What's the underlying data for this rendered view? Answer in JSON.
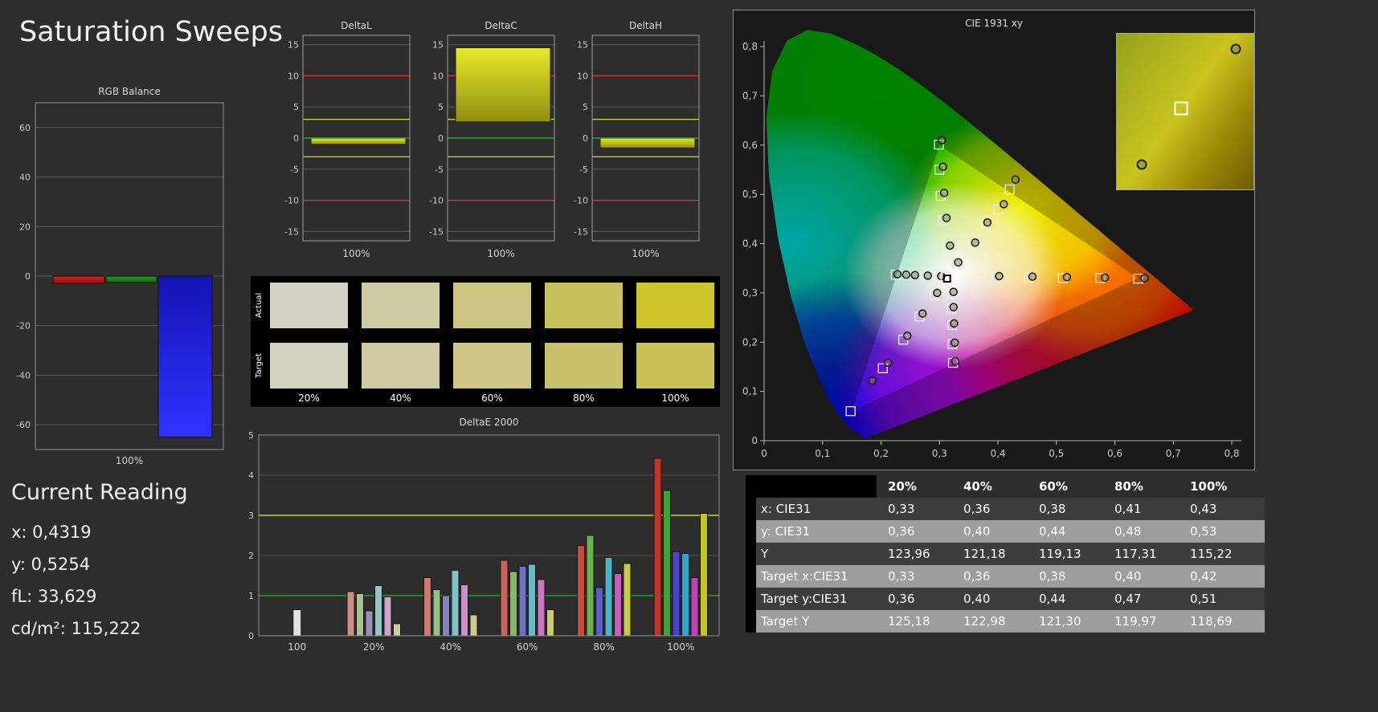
{
  "page_title": "Saturation Sweeps",
  "current_reading": {
    "heading": "Current Reading",
    "lines": [
      "x: 0,4319",
      "y: 0,5254",
      "fL: 33,629",
      "cd/m²: 115,222"
    ]
  },
  "swatches": {
    "row_labels": [
      "Actual",
      "Target"
    ],
    "col_labels": [
      "20%",
      "40%",
      "60%",
      "80%",
      "100%"
    ],
    "actual_colors": [
      "#d2d2c4",
      "#cecaa2",
      "#cbc581",
      "#c9c05e",
      "#cdc72d"
    ],
    "target_colors": [
      "#d4d2c0",
      "#d0cba0",
      "#cdc786",
      "#cac268",
      "#cbc356"
    ]
  },
  "table": {
    "headers": [
      "",
      "20%",
      "40%",
      "60%",
      "80%",
      "100%"
    ],
    "rows": [
      {
        "label": "x: CIE31",
        "shade": "dark",
        "values": [
          "0,33",
          "0,36",
          "0,38",
          "0,41",
          "0,43"
        ]
      },
      {
        "label": "y: CIE31",
        "shade": "light",
        "values": [
          "0,36",
          "0,40",
          "0,44",
          "0,48",
          "0,53"
        ]
      },
      {
        "label": "Y",
        "shade": "dark",
        "values": [
          "123,96",
          "121,18",
          "119,13",
          "117,31",
          "115,22"
        ]
      },
      {
        "label": "Target x:CIE31",
        "shade": "light",
        "values": [
          "0,33",
          "0,36",
          "0,38",
          "0,40",
          "0,42"
        ]
      },
      {
        "label": "Target y:CIE31",
        "shade": "dark",
        "values": [
          "0,36",
          "0,40",
          "0,44",
          "0,47",
          "0,51"
        ]
      },
      {
        "label": "Target Y",
        "shade": "light",
        "values": [
          "125,18",
          "122,98",
          "121,30",
          "119,97",
          "118,69"
        ]
      }
    ]
  },
  "chart_data": [
    {
      "id": "rgb_balance",
      "type": "bar",
      "title": "RGB Balance",
      "ylim": [
        -70,
        70
      ],
      "yticks": [
        60,
        40,
        20,
        0,
        -20,
        -40,
        -60
      ],
      "xlabel": "100%",
      "bars": [
        {
          "name": "red",
          "value": -3,
          "color_top": "#d81f1f",
          "color_bottom": "#8f1010"
        },
        {
          "name": "green",
          "value": -2.5,
          "color_top": "#1f9e1f",
          "color_bottom": "#0f6a0f"
        },
        {
          "name": "blue",
          "value": -65,
          "color_top": "#1414b4",
          "color_bottom": "#3232ff"
        }
      ]
    },
    {
      "id": "deltaL",
      "type": "bar",
      "title": "DeltaL",
      "ylim": [
        -15,
        15
      ],
      "yticks": [
        15,
        10,
        5,
        0,
        -5,
        -10,
        -15
      ],
      "xlabel": "100%",
      "ref_lines": {
        "red": [
          10,
          -10
        ],
        "yellow": [
          3,
          -3
        ],
        "green": [
          0
        ]
      },
      "bar": {
        "from": 0,
        "to": -1
      }
    },
    {
      "id": "deltaC",
      "type": "bar",
      "title": "DeltaC",
      "ylim": [
        -15,
        15
      ],
      "yticks": [
        15,
        10,
        5,
        0,
        -5,
        -10,
        -15
      ],
      "xlabel": "100%",
      "ref_lines": {
        "red": [
          10,
          -10
        ],
        "yellow": [
          3,
          -3
        ],
        "green": [
          0
        ]
      },
      "bar": {
        "from": 2.6,
        "to": 14.5
      }
    },
    {
      "id": "deltaH",
      "type": "bar",
      "title": "DeltaH",
      "ylim": [
        -15,
        15
      ],
      "yticks": [
        15,
        10,
        5,
        0,
        -5,
        -10,
        -15
      ],
      "xlabel": "100%",
      "ref_lines": {
        "red": [
          10,
          -10
        ],
        "yellow": [
          3,
          -3
        ],
        "green": [
          0
        ]
      },
      "bar": {
        "from": 0,
        "to": -1.6
      }
    },
    {
      "id": "deltaE2000",
      "type": "bar",
      "title": "DeltaE 2000",
      "ylim": [
        0,
        5
      ],
      "yticks": [
        0,
        1,
        2,
        3,
        4,
        5
      ],
      "ref_lines": [
        {
          "value": 3,
          "color": "#cdcd20"
        },
        {
          "value": 1,
          "color": "#28a028"
        }
      ],
      "groups": [
        {
          "label": "100",
          "values": [
            0.65
          ],
          "colors": [
            "#e2e2e2"
          ]
        },
        {
          "label": "20%",
          "values": [
            1.1,
            1.05,
            0.62,
            1.25,
            0.97,
            0.3
          ],
          "colors": [
            "#cf8d85",
            "#a9c093",
            "#9793b6",
            "#93c7c7",
            "#cfa4cb",
            "#cfcf9f"
          ]
        },
        {
          "label": "40%",
          "values": [
            1.45,
            1.15,
            1.0,
            1.63,
            1.27,
            0.52
          ],
          "colors": [
            "#cd7b6f",
            "#98bd81",
            "#8282bd",
            "#7fc3c9",
            "#cd90c9",
            "#cdcd87"
          ]
        },
        {
          "label": "60%",
          "values": [
            1.88,
            1.6,
            1.73,
            1.78,
            1.4,
            0.65
          ],
          "colors": [
            "#cb6458",
            "#84b968",
            "#7070c4",
            "#66bcc9",
            "#cb78c4",
            "#cbcb69"
          ]
        },
        {
          "label": "80%",
          "values": [
            2.25,
            2.5,
            1.2,
            1.95,
            1.55,
            1.8
          ],
          "colors": [
            "#c94c3e",
            "#69b14d",
            "#5c5ccb",
            "#4cb3c9",
            "#c95cbd",
            "#c9c947"
          ]
        },
        {
          "label": "100%",
          "values": [
            4.42,
            3.62,
            2.1,
            2.05,
            1.45,
            3.05
          ],
          "colors": [
            "#c43328",
            "#40a433",
            "#4444d1",
            "#30a7c9",
            "#c440b2",
            "#c6c620"
          ]
        }
      ]
    },
    {
      "id": "cie",
      "type": "scatter",
      "title": "CIE 1931 xy",
      "xlim": [
        0,
        0.8
      ],
      "ylim": [
        0,
        0.8
      ],
      "xtick_labels": [
        "0",
        "0,1",
        "0,2",
        "0,3",
        "0,4",
        "0,5",
        "0,6",
        "0,7",
        "0,8"
      ],
      "ytick_labels": [
        "0",
        "0,1",
        "0,2",
        "0,3",
        "0,4",
        "0,5",
        "0,6",
        "0,7",
        "0,8"
      ],
      "triangle": [
        [
          0.64,
          0.33
        ],
        [
          0.3,
          0.6
        ],
        [
          0.15,
          0.06
        ]
      ],
      "white_point": [
        0.313,
        0.329
      ],
      "sweeps": [
        {
          "name": "red",
          "targets": [
            [
              0.397,
              0.332
            ],
            [
              0.453,
              0.331
            ],
            [
              0.511,
              0.33
            ],
            [
              0.575,
              0.33
            ],
            [
              0.64,
              0.329
            ]
          ],
          "measured": [
            [
              0.402,
              0.334
            ],
            [
              0.459,
              0.333
            ],
            [
              0.518,
              0.332
            ],
            [
              0.583,
              0.331
            ],
            [
              0.651,
              0.33
            ]
          ]
        },
        {
          "name": "green",
          "targets": [
            [
              0.313,
              0.392
            ],
            [
              0.306,
              0.447
            ],
            [
              0.302,
              0.497
            ],
            [
              0.3,
              0.55
            ],
            [
              0.299,
              0.601
            ]
          ],
          "measured": [
            [
              0.318,
              0.396
            ],
            [
              0.312,
              0.452
            ],
            [
              0.308,
              0.503
            ],
            [
              0.306,
              0.556
            ],
            [
              0.304,
              0.61
            ]
          ]
        },
        {
          "name": "blue",
          "targets": [
            [
              0.292,
              0.296
            ],
            [
              0.266,
              0.252
            ],
            [
              0.238,
              0.205
            ],
            [
              0.203,
              0.147
            ],
            [
              0.148,
              0.06
            ]
          ],
          "measured": [
            [
              0.296,
              0.3
            ],
            [
              0.271,
              0.258
            ],
            [
              0.245,
              0.213
            ],
            [
              0.212,
              0.158
            ],
            [
              0.185,
              0.122
            ]
          ]
        },
        {
          "name": "cyan",
          "targets": [
            [
              0.301,
              0.333
            ],
            [
              0.277,
              0.334
            ],
            [
              0.254,
              0.335
            ],
            [
              0.24,
              0.336
            ],
            [
              0.225,
              0.337
            ]
          ],
          "measured": [
            [
              0.303,
              0.334
            ],
            [
              0.28,
              0.335
            ],
            [
              0.258,
              0.336
            ],
            [
              0.243,
              0.337
            ],
            [
              0.228,
              0.338
            ]
          ]
        },
        {
          "name": "magenta",
          "targets": [
            [
              0.321,
              0.299
            ],
            [
              0.321,
              0.268
            ],
            [
              0.322,
              0.235
            ],
            [
              0.322,
              0.196
            ],
            [
              0.323,
              0.158
            ]
          ],
          "measured": [
            [
              0.324,
              0.302
            ],
            [
              0.324,
              0.271
            ],
            [
              0.325,
              0.238
            ],
            [
              0.326,
              0.199
            ],
            [
              0.327,
              0.161
            ]
          ]
        },
        {
          "name": "yellow",
          "targets": [
            [
              0.33,
              0.36
            ],
            [
              0.36,
              0.4
            ],
            [
              0.38,
              0.44
            ],
            [
              0.4,
              0.47
            ],
            [
              0.42,
              0.51
            ]
          ],
          "measured": [
            [
              0.332,
              0.362
            ],
            [
              0.361,
              0.402
            ],
            [
              0.382,
              0.443
            ],
            [
              0.41,
              0.48
            ],
            [
              0.43,
              0.53
            ]
          ]
        }
      ],
      "inset": {
        "square": [
          0.47,
          0.48
        ],
        "circles": [
          [
            0.87,
            0.1
          ],
          [
            0.18,
            0.84
          ]
        ]
      }
    }
  ]
}
